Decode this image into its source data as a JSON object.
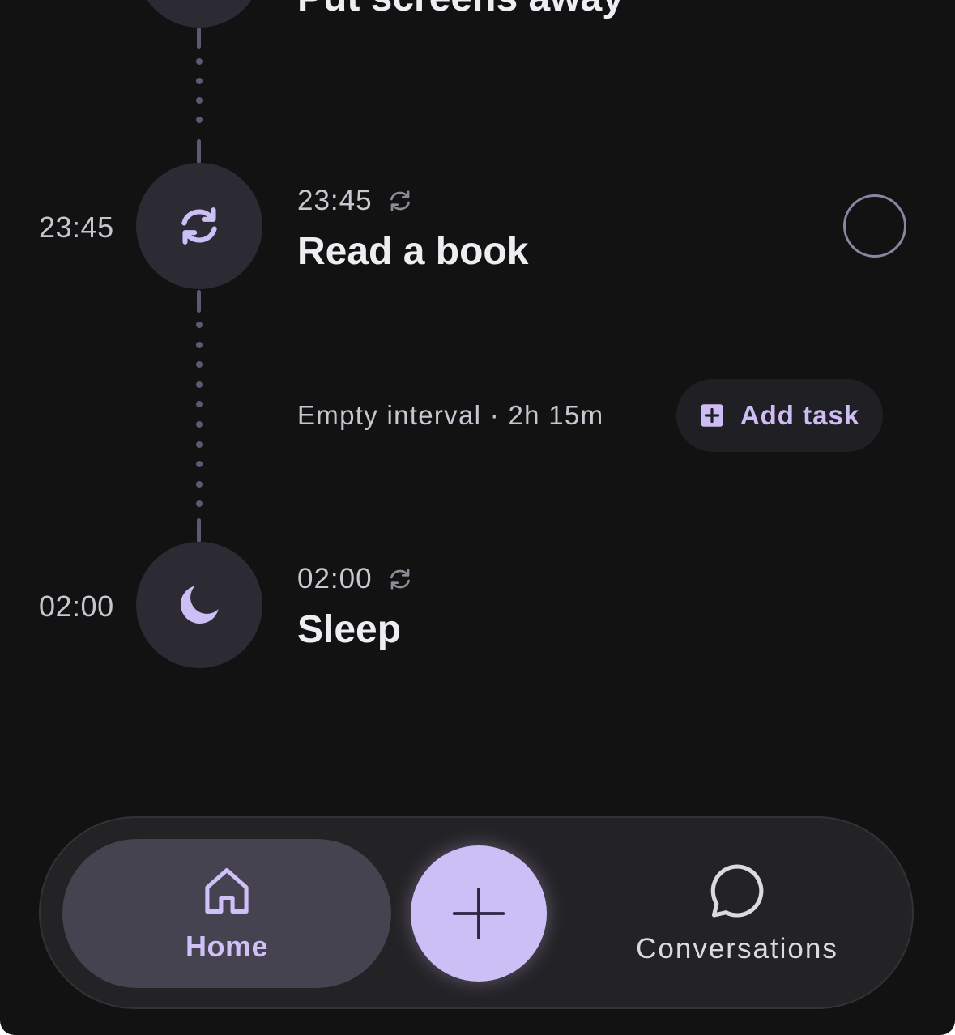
{
  "timeline": {
    "previous_task": {
      "title": "Put screens away"
    },
    "tasks": [
      {
        "side_time": "23:45",
        "time": "23:45",
        "title": "Read a book",
        "node_icon": "repeat-icon",
        "repeat_icon": "repeat-icon",
        "completed": false
      },
      {
        "side_time": "02:00",
        "time": "02:00",
        "title": "Sleep",
        "node_icon": "moon-icon",
        "repeat_icon": "repeat-icon"
      }
    ],
    "empty_interval": {
      "text": "Empty interval · 2h 15m",
      "add_button_label": "Add task"
    }
  },
  "navbar": {
    "home_label": "Home",
    "fab_icon": "plus-icon",
    "conversations_label": "Conversations",
    "active_tab": "Home"
  },
  "colors": {
    "background": "#121212",
    "accent": "#cbbff6",
    "node": "#2c2a33",
    "connector": "#5f5873"
  }
}
